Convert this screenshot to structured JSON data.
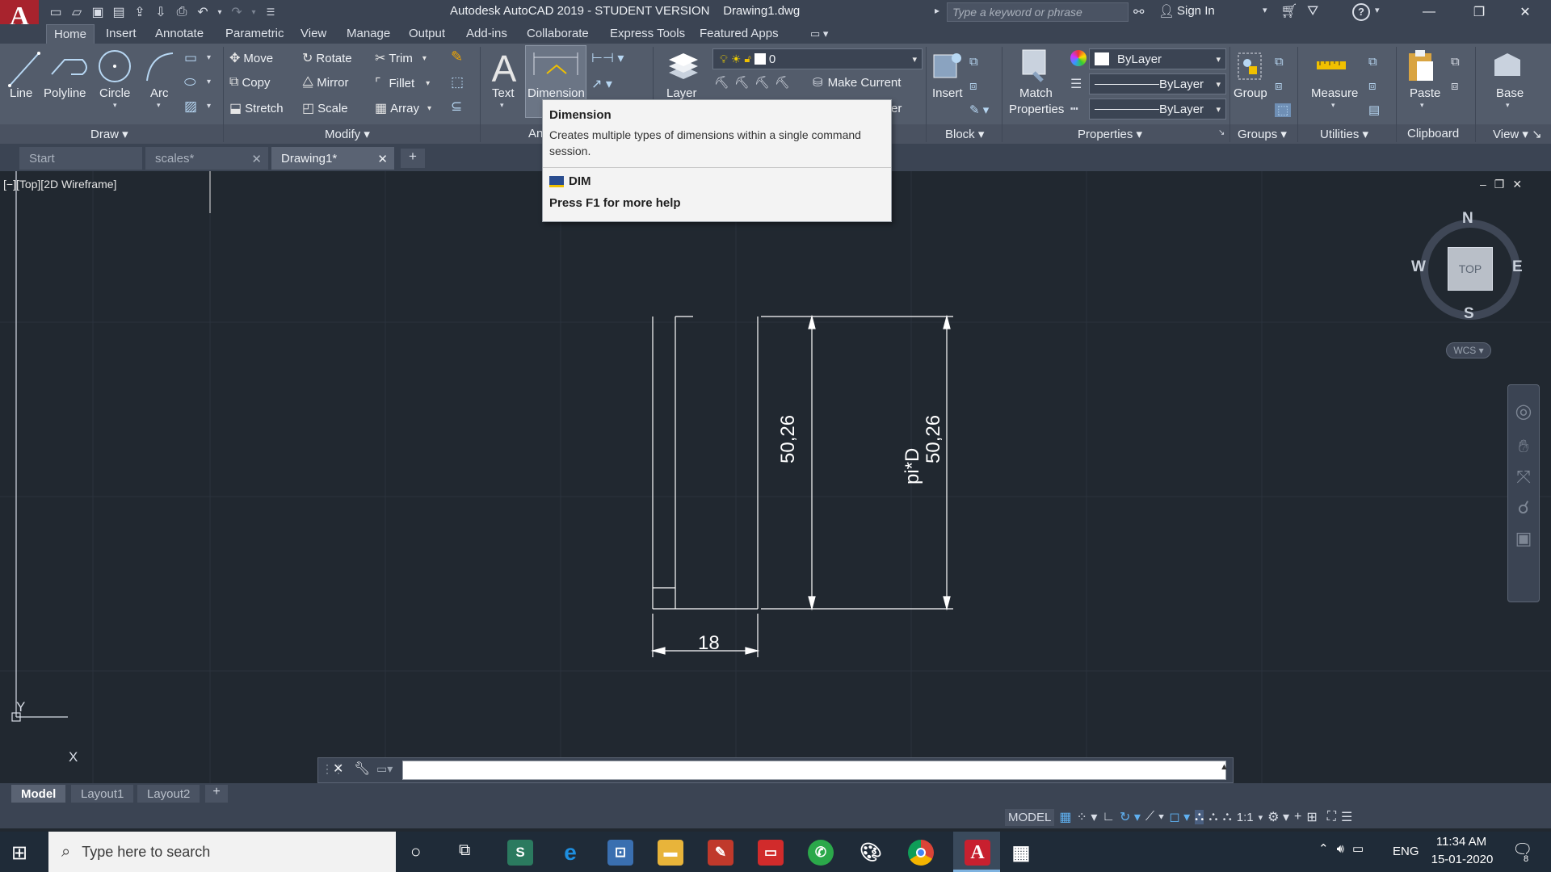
{
  "app": {
    "logo": "A",
    "title": "Autodesk AutoCAD 2019 - STUDENT VERSION    Drawing1.dwg",
    "search_placeholder": "Type a keyword or phrase",
    "signin_label": "Sign In"
  },
  "ribbon_tabs": [
    "Home",
    "Insert",
    "Annotate",
    "Parametric",
    "View",
    "Manage",
    "Output",
    "Add-ins",
    "Collaborate",
    "Express Tools",
    "Featured Apps"
  ],
  "draw": {
    "line": "Line",
    "polyline": "Polyline",
    "circle": "Circle",
    "arc": "Arc",
    "panel": "Draw"
  },
  "modify": {
    "move": "Move",
    "rotate": "Rotate",
    "trim": "Trim",
    "copy": "Copy",
    "mirror": "Mirror",
    "fillet": "Fillet",
    "stretch": "Stretch",
    "scale": "Scale",
    "array": "Array",
    "panel": "Modify"
  },
  "annotation": {
    "text": "Text",
    "dimension": "Dimension",
    "panel": "An"
  },
  "layers": {
    "layer": "Layer",
    "current_layer": "0",
    "make_current": "Make Current",
    "hidden_suffix": "er"
  },
  "block": {
    "insert": "Insert",
    "panel": "Block"
  },
  "properties": {
    "match": "Match",
    "match2": "Properties",
    "color": "ByLayer",
    "linetype": "ByLayer",
    "lineweight": "ByLayer",
    "panel": "Properties"
  },
  "groups": {
    "group": "Group",
    "panel": "Groups"
  },
  "utilities": {
    "measure": "Measure",
    "panel": "Utilities"
  },
  "clipboard": {
    "paste": "Paste",
    "panel": "Clipboard"
  },
  "view_panel": {
    "base": "Base",
    "panel": "View"
  },
  "doc_tabs": [
    "Start",
    "scales*",
    "Drawing1*"
  ],
  "tooltip": {
    "title": "Dimension",
    "description": "Creates multiple types of dimensions within a single command session.",
    "command": "DIM",
    "help": "Press F1 for more help"
  },
  "viewport": {
    "label": "[−][Top][2D Wireframe]",
    "viewcube": {
      "north": "N",
      "south": "S",
      "east": "E",
      "west": "W",
      "top": "TOP",
      "wcs": "WCS"
    },
    "ucs": {
      "x": "X",
      "y": "Y"
    }
  },
  "drawing": {
    "dim_width": "18",
    "dim_height_left": "50,26",
    "dim_height_right": "50,26",
    "dim_right_prefix": "pi*D"
  },
  "layout_tabs": [
    "Model",
    "Layout1",
    "Layout2"
  ],
  "status": {
    "model": "MODEL",
    "scale": "1:1"
  },
  "taskbar": {
    "search_placeholder": "Type here to search",
    "lang": "ENG",
    "time": "11:34 AM",
    "date": "15-01-2020",
    "notifications": "8"
  },
  "colors": {
    "accent_red": "#a8232d",
    "canvas": "#212830",
    "ribbon": "#535c6b"
  }
}
